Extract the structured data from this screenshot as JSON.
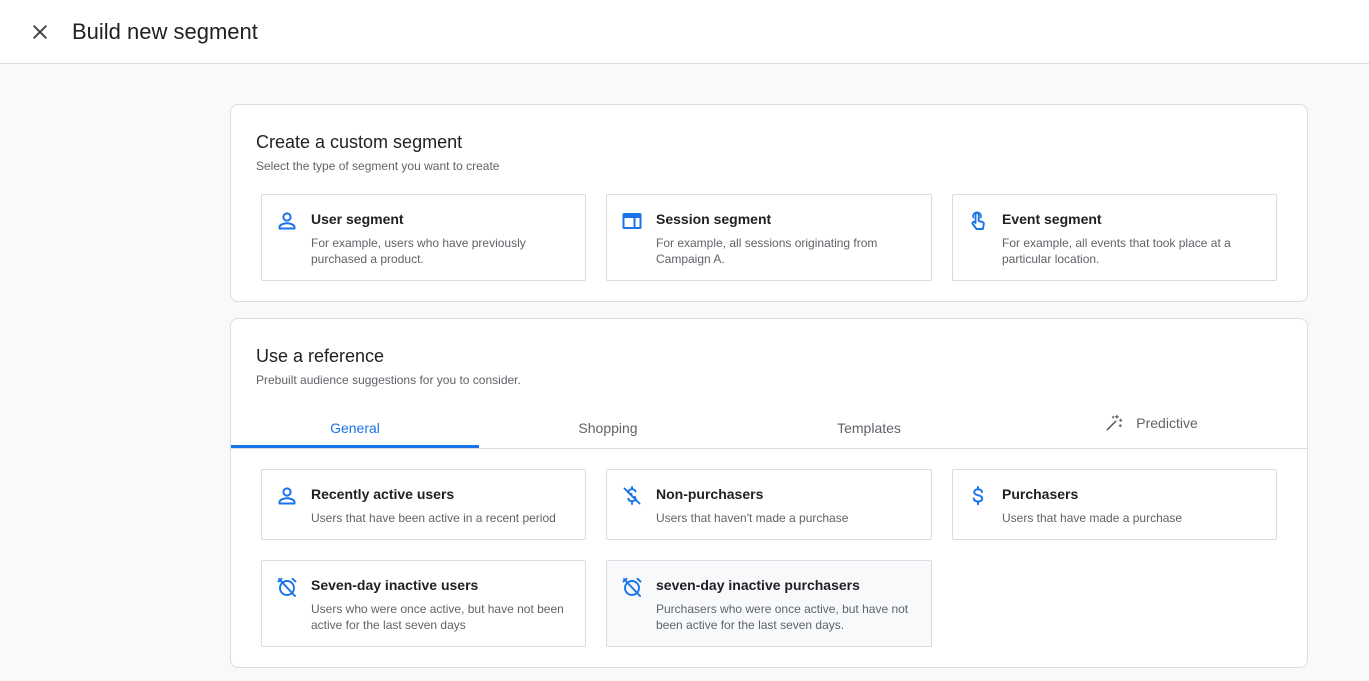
{
  "header": {
    "title": "Build new segment"
  },
  "custom_segment": {
    "title": "Create a custom segment",
    "subtitle": "Select the type of segment you want to create",
    "cards": [
      {
        "title": "User segment",
        "desc": "For example, users who have previously purchased a product.",
        "icon": "person-icon"
      },
      {
        "title": "Session segment",
        "desc": "For example, all sessions originating from Campaign A.",
        "icon": "web-window-icon"
      },
      {
        "title": "Event segment",
        "desc": "For example, all events that took place at a particular location.",
        "icon": "touch-icon"
      }
    ]
  },
  "reference": {
    "title": "Use a reference",
    "subtitle": "Prebuilt audience suggestions for you to consider.",
    "tabs": [
      {
        "label": "General",
        "active": true
      },
      {
        "label": "Shopping",
        "active": false
      },
      {
        "label": "Templates",
        "active": false
      },
      {
        "label": "Predictive",
        "active": false,
        "icon": "magic-wand-icon"
      }
    ],
    "cards": [
      {
        "title": "Recently active users",
        "desc": "Users that have been active in a recent period",
        "icon": "person-icon"
      },
      {
        "title": "Non-purchasers",
        "desc": "Users that haven't made a purchase",
        "icon": "money-off-icon"
      },
      {
        "title": "Purchasers",
        "desc": "Users that have made a purchase",
        "icon": "dollar-icon"
      },
      {
        "title": "Seven-day inactive users",
        "desc": "Users who were once active, but have not been active for the last seven days",
        "icon": "alarm-off-icon"
      },
      {
        "title": "seven-day inactive purchasers",
        "desc": "Purchasers who were once active, but have not been active for the last seven days.",
        "icon": "alarm-off-icon"
      }
    ]
  },
  "colors": {
    "accent": "#1a73e8",
    "border": "#dadce0",
    "text_primary": "#202124",
    "text_secondary": "#5f6368",
    "background": "#f8f9fa"
  }
}
